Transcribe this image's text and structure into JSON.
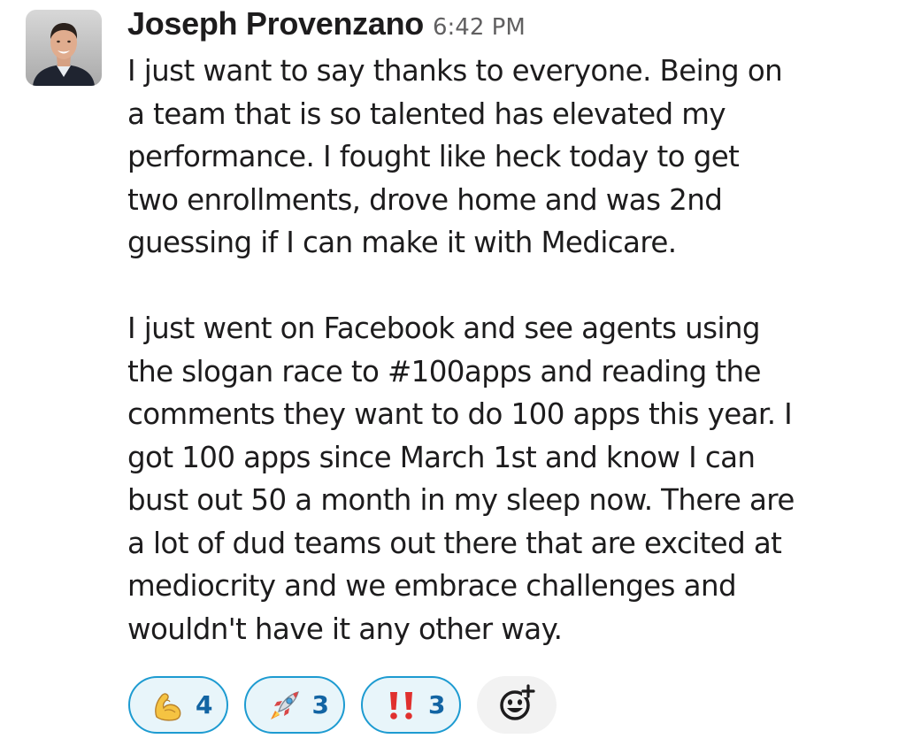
{
  "message": {
    "sender": "Joseph Provenzano",
    "timestamp": "6:42 PM",
    "paragraphs": [
      {
        "lines": [
          "I just want to say thanks to everyone. Being on",
          "a team that is so talented has elevated my",
          "performance. I fought like heck today to get",
          "two enrollments, drove home and was 2nd",
          "guessing if I can make it with Medicare."
        ]
      },
      {
        "lines": [
          "I just went on Facebook and see agents using",
          "the slogan race to #100apps and reading the",
          "comments they want to do 100 apps this year. I",
          "got 100 apps since March 1st and know I can",
          "bust out 50 a month in my sleep now. There are",
          "a lot of dud teams out there that are excited at",
          "mediocrity and we embrace challenges and",
          "wouldn't have it any other way."
        ]
      }
    ]
  },
  "reactions": [
    {
      "icon": "flexed-biceps-icon",
      "count": "4"
    },
    {
      "icon": "rocket-icon",
      "count": "3"
    },
    {
      "icon": "double-exclamation-icon",
      "count": "3"
    }
  ],
  "add_reaction": {
    "icon": "add-reaction-icon"
  },
  "colors": {
    "reaction_border": "#1d9bd1",
    "reaction_background": "#e8f5fa",
    "reaction_count": "#1264a3",
    "timestamp": "#616061",
    "text": "#1d1c1d"
  }
}
